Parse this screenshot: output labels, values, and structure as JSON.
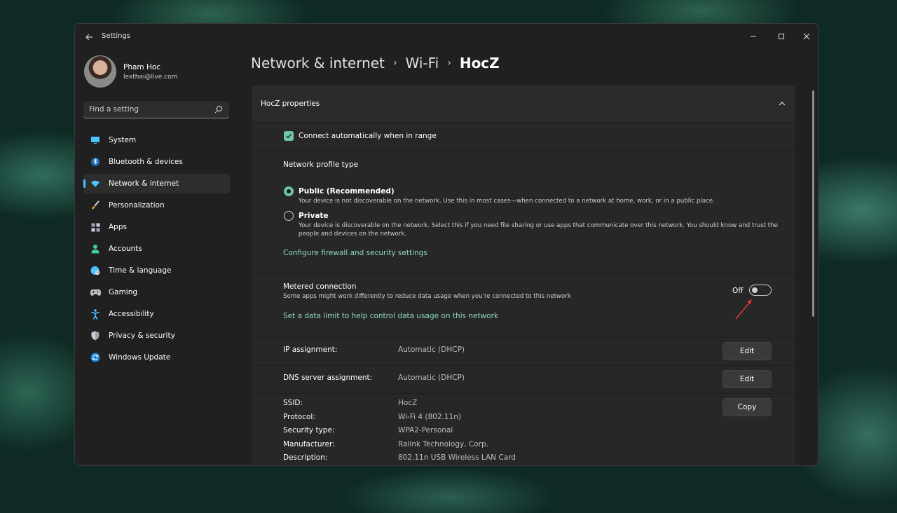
{
  "window": {
    "title": "Settings"
  },
  "profile": {
    "name": "Pham Hoc",
    "email": "lexthai@live.com"
  },
  "search": {
    "placeholder": "Find a setting"
  },
  "nav": [
    {
      "label": "System",
      "icon": "monitor-icon",
      "color": "#4cc2ff"
    },
    {
      "label": "Bluetooth & devices",
      "icon": "bluetooth-icon",
      "color": "#4cc2ff"
    },
    {
      "label": "Network & internet",
      "icon": "wifi-icon",
      "color": "#4cc2ff",
      "active": true
    },
    {
      "label": "Personalization",
      "icon": "brush-icon",
      "color": "#e8a33a"
    },
    {
      "label": "Apps",
      "icon": "apps-icon",
      "color": "#9aa4b3"
    },
    {
      "label": "Accounts",
      "icon": "person-icon",
      "color": "#3fcf9e"
    },
    {
      "label": "Time & language",
      "icon": "globe-icon",
      "color": "#4cc2ff"
    },
    {
      "label": "Gaming",
      "icon": "gamepad-icon",
      "color": "#bdbdbd"
    },
    {
      "label": "Accessibility",
      "icon": "accessibility-icon",
      "color": "#4cc2ff"
    },
    {
      "label": "Privacy & security",
      "icon": "shield-icon",
      "color": "#9aa4b3"
    },
    {
      "label": "Windows Update",
      "icon": "update-icon",
      "color": "#4cc2ff"
    }
  ],
  "breadcrumb": {
    "level1": "Network & internet",
    "level2": "Wi-Fi",
    "current": "HocZ"
  },
  "properties": {
    "title": "HocZ properties",
    "connect_auto": "Connect automatically when in range",
    "profile_type_label": "Network profile type",
    "public_label": "Public (Recommended)",
    "public_desc": "Your device is not discoverable on the network. Use this in most cases—when connected to a network at home, work, or in a public place.",
    "private_label": "Private",
    "private_desc": "Your device is discoverable on the network. Select this if you need file sharing or use apps that communicate over this network. You should know and trust the people and devices on the network.",
    "firewall_link": "Configure firewall and security settings",
    "metered_label": "Metered connection",
    "metered_desc": "Some apps might work differently to reduce data usage when you're connected to this network",
    "metered_state": "Off",
    "data_limit_link": "Set a data limit to help control data usage on this network",
    "ip_label": "IP assignment:",
    "ip_value": "Automatic (DHCP)",
    "dns_label": "DNS server assignment:",
    "dns_value": "Automatic (DHCP)",
    "edit_label": "Edit",
    "copy_label": "Copy",
    "ssid_label": "SSID:",
    "ssid_value": "HocZ",
    "protocol_label": "Protocol:",
    "protocol_value": "Wi-Fi 4 (802.11n)",
    "security_label": "Security type:",
    "security_value": "WPA2-Personal",
    "manufacturer_label": "Manufacturer:",
    "manufacturer_value": "Ralink Technology, Corp.",
    "description_label": "Description:",
    "description_value": "802.11n USB Wireless LAN Card"
  }
}
